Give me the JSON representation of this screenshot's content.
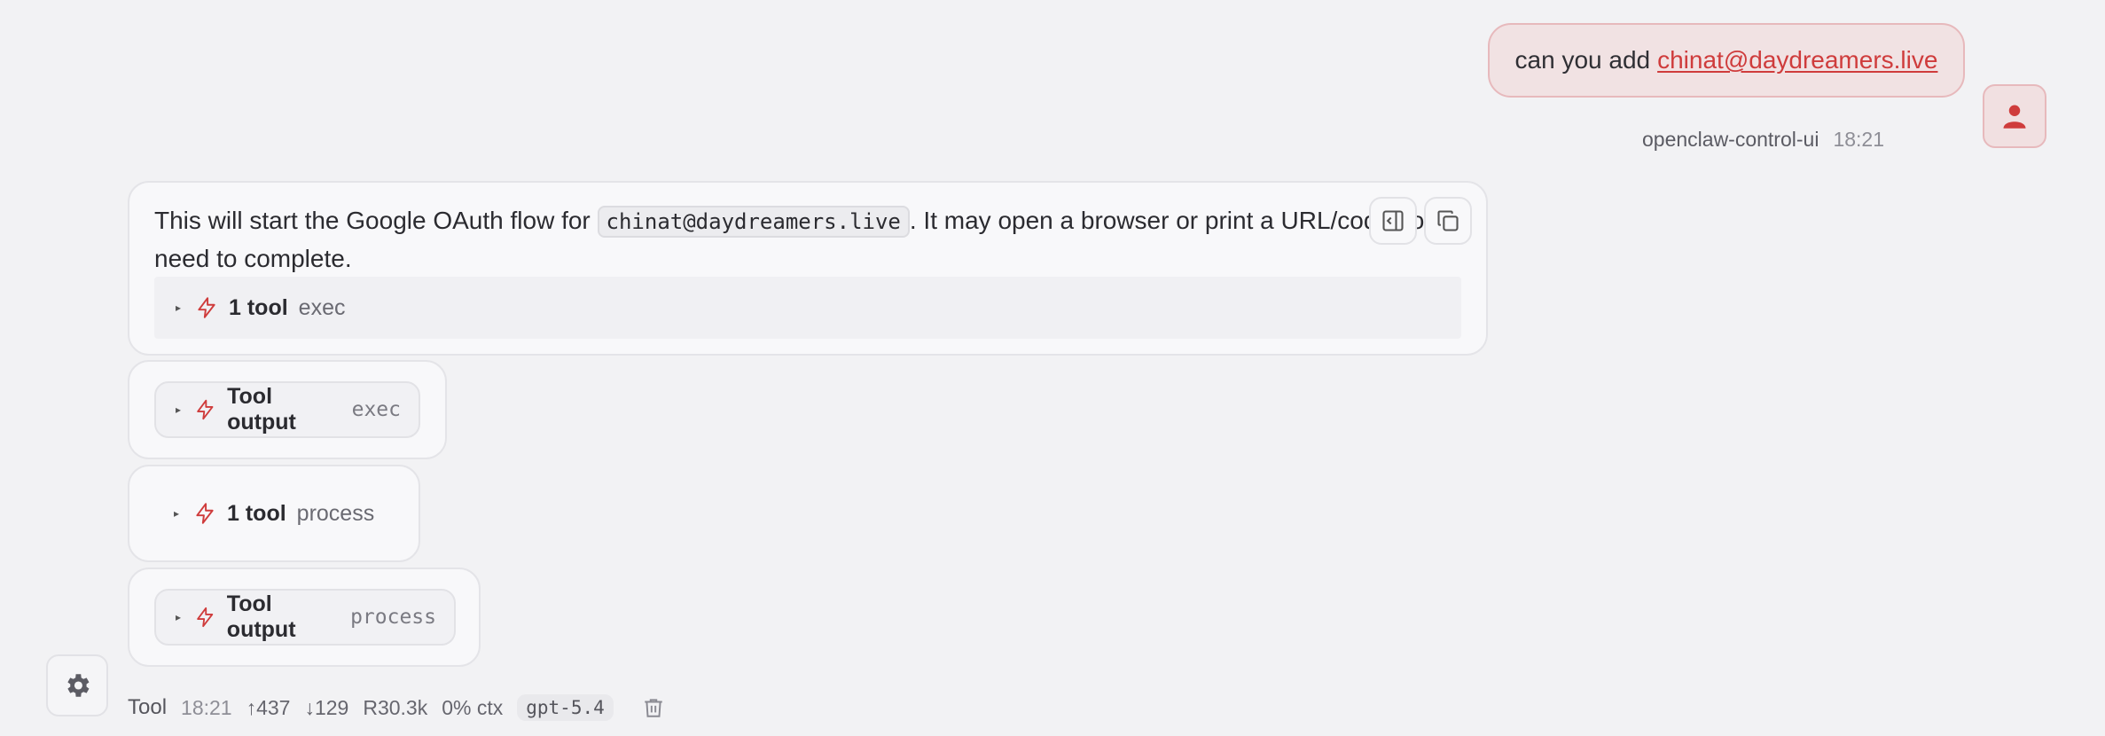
{
  "user_message": {
    "prefix": "can you add",
    "link": "chinat@daydreamers.live",
    "sender": "openclaw-control-ui",
    "time": "18:21",
    "avatar_icon": "user-icon"
  },
  "assistant": {
    "text_before": "This will start the Google OAuth flow for ",
    "code": "chinat@daydreamers.live",
    "text_after": ". It may open a browser or print a URL/code you’ll need to complete.",
    "actions": {
      "expand_icon": "panel-expand-icon",
      "copy_icon": "copy-icon"
    },
    "tool_group": {
      "count_label": "1 tool",
      "name": "exec"
    }
  },
  "tool_cards": [
    {
      "label": "Tool output",
      "name": "exec"
    },
    {
      "label": "1 tool",
      "name": "process"
    },
    {
      "label": "Tool output",
      "name": "process"
    }
  ],
  "footer": {
    "role": "Tool",
    "time": "18:21",
    "tokens_in": "↑437",
    "tokens_out": "↓129",
    "reads": "R30.3k",
    "ctx": "0% ctx",
    "model": "gpt-5.4"
  },
  "colors": {
    "accent": "#cf3c3c",
    "background": "#f2f2f4"
  }
}
